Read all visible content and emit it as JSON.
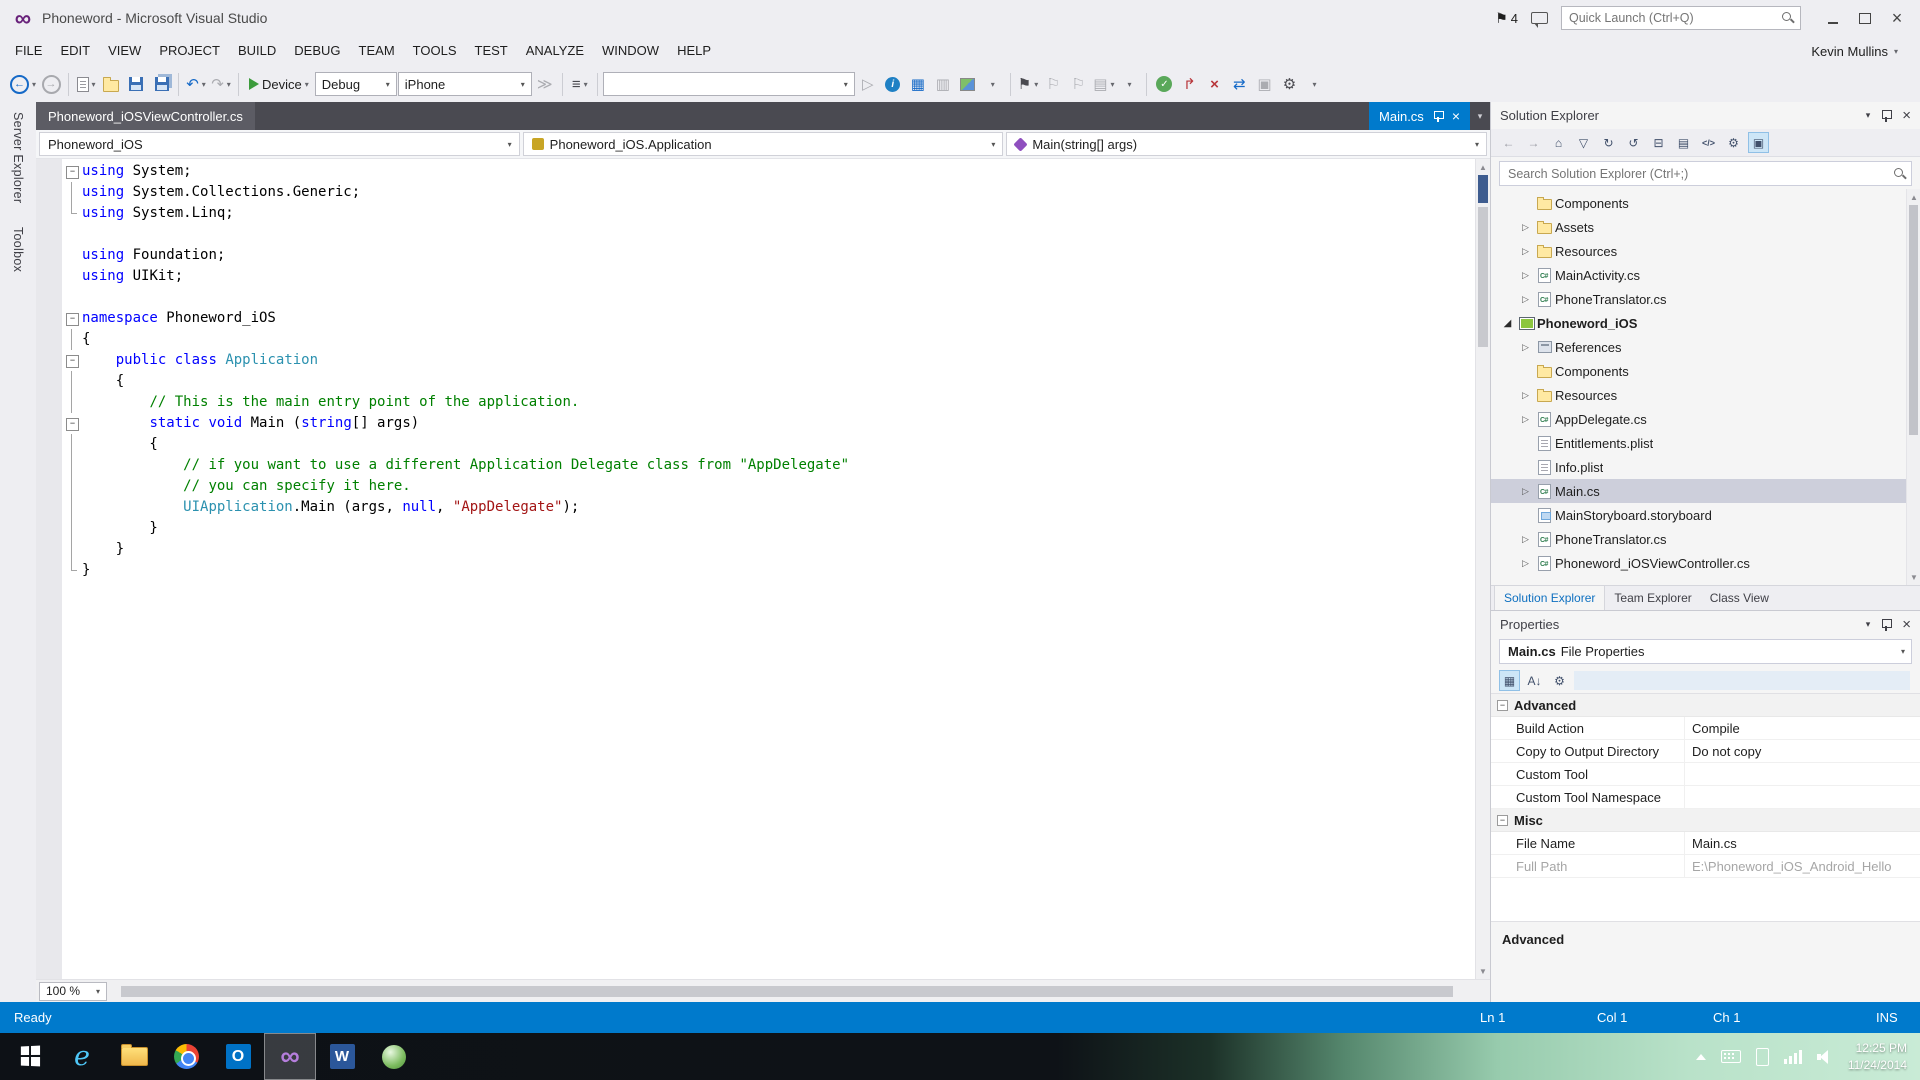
{
  "window": {
    "title": "Phoneword - Microsoft Visual Studio",
    "notification_count": "4",
    "quick_launch_placeholder": "Quick Launch (Ctrl+Q)",
    "user_name": "Kevin Mullins"
  },
  "menu": {
    "items": [
      "FILE",
      "EDIT",
      "VIEW",
      "PROJECT",
      "BUILD",
      "DEBUG",
      "TEAM",
      "TOOLS",
      "TEST",
      "ANALYZE",
      "WINDOW",
      "HELP"
    ]
  },
  "toolbar": {
    "start_label": "Device",
    "configuration": "Debug",
    "device": "iPhone",
    "items": [
      "back",
      "forward",
      "sep",
      "new-file",
      "open",
      "save",
      "save-all",
      "sep",
      "undo",
      "redo",
      "sep",
      "start",
      "config-combo",
      "device-combo",
      "step",
      "sep",
      "navto",
      "sep",
      "find-combo",
      "run-gray",
      "info",
      "grid",
      "layout",
      "image",
      "dd",
      "sep",
      "bookmark",
      "bm-prev",
      "bm-next",
      "bm-folder",
      "dd",
      "sep",
      "check",
      "branch",
      "cancel",
      "sync",
      "package",
      "wrench",
      "overflow"
    ]
  },
  "side_tabs": [
    "Server Explorer",
    "Toolbox"
  ],
  "editor": {
    "open_tab": "Phoneword_iOSViewController.cs",
    "preview_tab": "Main.cs",
    "navigation": {
      "project": "Phoneword_iOS",
      "type": "Phoneword_iOS.Application",
      "member": "Main(string[] args)"
    },
    "zoom": "100 %",
    "code": [
      {
        "g": "box",
        "s": [
          [
            "k",
            "using"
          ],
          [
            "p",
            " System;"
          ]
        ]
      },
      {
        "g": "line",
        "s": [
          [
            "k",
            "using"
          ],
          [
            "p",
            " System.Collections.Generic;"
          ]
        ]
      },
      {
        "g": "end",
        "s": [
          [
            "k",
            "using"
          ],
          [
            "p",
            " System.Linq;"
          ]
        ]
      },
      {
        "g": "",
        "s": []
      },
      {
        "g": "",
        "s": [
          [
            "k",
            "using"
          ],
          [
            "p",
            " Foundation;"
          ]
        ]
      },
      {
        "g": "",
        "s": [
          [
            "k",
            "using"
          ],
          [
            "p",
            " UIKit;"
          ]
        ]
      },
      {
        "g": "",
        "s": []
      },
      {
        "g": "box",
        "s": [
          [
            "k",
            "namespace"
          ],
          [
            "p",
            " Phoneword_iOS"
          ]
        ]
      },
      {
        "g": "line",
        "s": [
          [
            "p",
            "{"
          ]
        ]
      },
      {
        "g": "box",
        "s": [
          [
            "p",
            "    "
          ],
          [
            "k",
            "public"
          ],
          [
            "p",
            " "
          ],
          [
            "k",
            "class"
          ],
          [
            "p",
            " "
          ],
          [
            "t",
            "Application"
          ]
        ]
      },
      {
        "g": "line",
        "s": [
          [
            "p",
            "    {"
          ]
        ]
      },
      {
        "g": "line",
        "s": [
          [
            "p",
            "        "
          ],
          [
            "c",
            "// This is the main entry point of the application."
          ]
        ]
      },
      {
        "g": "box",
        "s": [
          [
            "p",
            "        "
          ],
          [
            "k",
            "static"
          ],
          [
            "p",
            " "
          ],
          [
            "k",
            "void"
          ],
          [
            "p",
            " Main ("
          ],
          [
            "k",
            "string"
          ],
          [
            "p",
            "[] args)"
          ]
        ]
      },
      {
        "g": "line",
        "s": [
          [
            "p",
            "        {"
          ]
        ]
      },
      {
        "g": "line",
        "s": [
          [
            "p",
            "            "
          ],
          [
            "c",
            "// if you want to use a different Application Delegate class from \"AppDelegate\""
          ]
        ]
      },
      {
        "g": "line",
        "s": [
          [
            "p",
            "            "
          ],
          [
            "c",
            "// you can specify it here."
          ]
        ]
      },
      {
        "g": "line",
        "s": [
          [
            "p",
            "            "
          ],
          [
            "t",
            "UIApplication"
          ],
          [
            "p",
            ".Main (args, "
          ],
          [
            "k",
            "null"
          ],
          [
            "p",
            ", "
          ],
          [
            "s",
            "\"AppDelegate\""
          ],
          [
            "p",
            ");"
          ]
        ]
      },
      {
        "g": "line",
        "s": [
          [
            "p",
            "        }"
          ]
        ]
      },
      {
        "g": "line",
        "s": [
          [
            "p",
            "    }"
          ]
        ]
      },
      {
        "g": "end",
        "s": [
          [
            "p",
            "}"
          ]
        ]
      }
    ]
  },
  "solution_explorer": {
    "title": "Solution Explorer",
    "search_placeholder": "Search Solution Explorer (Ctrl+;)",
    "toolbar_icons": [
      "back",
      "forward",
      "home",
      "filter",
      "sync",
      "refresh",
      "collapse-all",
      "show-all-files",
      "view-code",
      "wrench",
      "preview-toggle"
    ],
    "items": [
      {
        "label": "Components",
        "icon": "folder",
        "level": 2,
        "expander": "none"
      },
      {
        "label": "Assets",
        "icon": "folder",
        "level": 2,
        "expander": "collapsed"
      },
      {
        "label": "Resources",
        "icon": "folder",
        "level": 2,
        "expander": "collapsed"
      },
      {
        "label": "MainActivity.cs",
        "icon": "csharp",
        "level": 2,
        "expander": "collapsed"
      },
      {
        "label": "PhoneTranslator.cs",
        "icon": "csharp",
        "level": 2,
        "expander": "collapsed"
      },
      {
        "label": "Phoneword_iOS",
        "icon": "project",
        "level": 1,
        "expander": "expanded",
        "bold": true
      },
      {
        "label": "References",
        "icon": "references",
        "level": 2,
        "expander": "collapsed"
      },
      {
        "label": "Components",
        "icon": "folder",
        "level": 2,
        "expander": "none"
      },
      {
        "label": "Resources",
        "icon": "folder",
        "level": 2,
        "expander": "collapsed"
      },
      {
        "label": "AppDelegate.cs",
        "icon": "csharp",
        "level": 2,
        "expander": "collapsed"
      },
      {
        "label": "Entitlements.plist",
        "icon": "plist",
        "level": 2,
        "expander": "none"
      },
      {
        "label": "Info.plist",
        "icon": "plist",
        "level": 2,
        "expander": "none"
      },
      {
        "label": "Main.cs",
        "icon": "csharp",
        "level": 2,
        "expander": "collapsed",
        "selected": true
      },
      {
        "label": "MainStoryboard.storyboard",
        "icon": "storyboard",
        "level": 2,
        "expander": "none"
      },
      {
        "label": "PhoneTranslator.cs",
        "icon": "csharp",
        "level": 2,
        "expander": "collapsed"
      },
      {
        "label": "Phoneword_iOSViewController.cs",
        "icon": "csharp",
        "level": 2,
        "expander": "collapsed"
      }
    ],
    "tabs": [
      {
        "label": "Solution Explorer",
        "active": true
      },
      {
        "label": "Team Explorer"
      },
      {
        "label": "Class View"
      }
    ]
  },
  "properties": {
    "title": "Properties",
    "object_name": "Main.cs",
    "object_type": "File Properties",
    "toolbar_icons": [
      "categorized",
      "alphabetical",
      "property-pages"
    ],
    "rows": [
      {
        "kind": "section",
        "label": "Advanced"
      },
      {
        "kind": "prop",
        "name": "Build Action",
        "value": "Compile"
      },
      {
        "kind": "prop",
        "name": "Copy to Output Directory",
        "value": "Do not copy"
      },
      {
        "kind": "prop",
        "name": "Custom Tool",
        "value": ""
      },
      {
        "kind": "prop",
        "name": "Custom Tool Namespace",
        "value": ""
      },
      {
        "kind": "section",
        "label": "Misc"
      },
      {
        "kind": "prop",
        "name": "File Name",
        "value": "Main.cs"
      },
      {
        "kind": "prop",
        "name": "Full Path",
        "value": "E:\\Phoneword_iOS_Android_Hello",
        "muted": true
      }
    ],
    "description_title": "Advanced"
  },
  "status_bar": {
    "message": "Ready",
    "line": "Ln 1",
    "column": "Col 1",
    "character": "Ch 1",
    "mode": "INS"
  },
  "taskbar": {
    "apps": [
      {
        "name": "start"
      },
      {
        "name": "internet-explorer"
      },
      {
        "name": "file-explorer"
      },
      {
        "name": "chrome"
      },
      {
        "name": "outlook"
      },
      {
        "name": "visual-studio",
        "active": true
      },
      {
        "name": "word"
      },
      {
        "name": "green-app"
      }
    ],
    "tray_icons": [
      "chevron-up",
      "keyboard",
      "tablet",
      "network",
      "volume"
    ],
    "time": "12:25 PM",
    "date": "11/24/2014"
  }
}
